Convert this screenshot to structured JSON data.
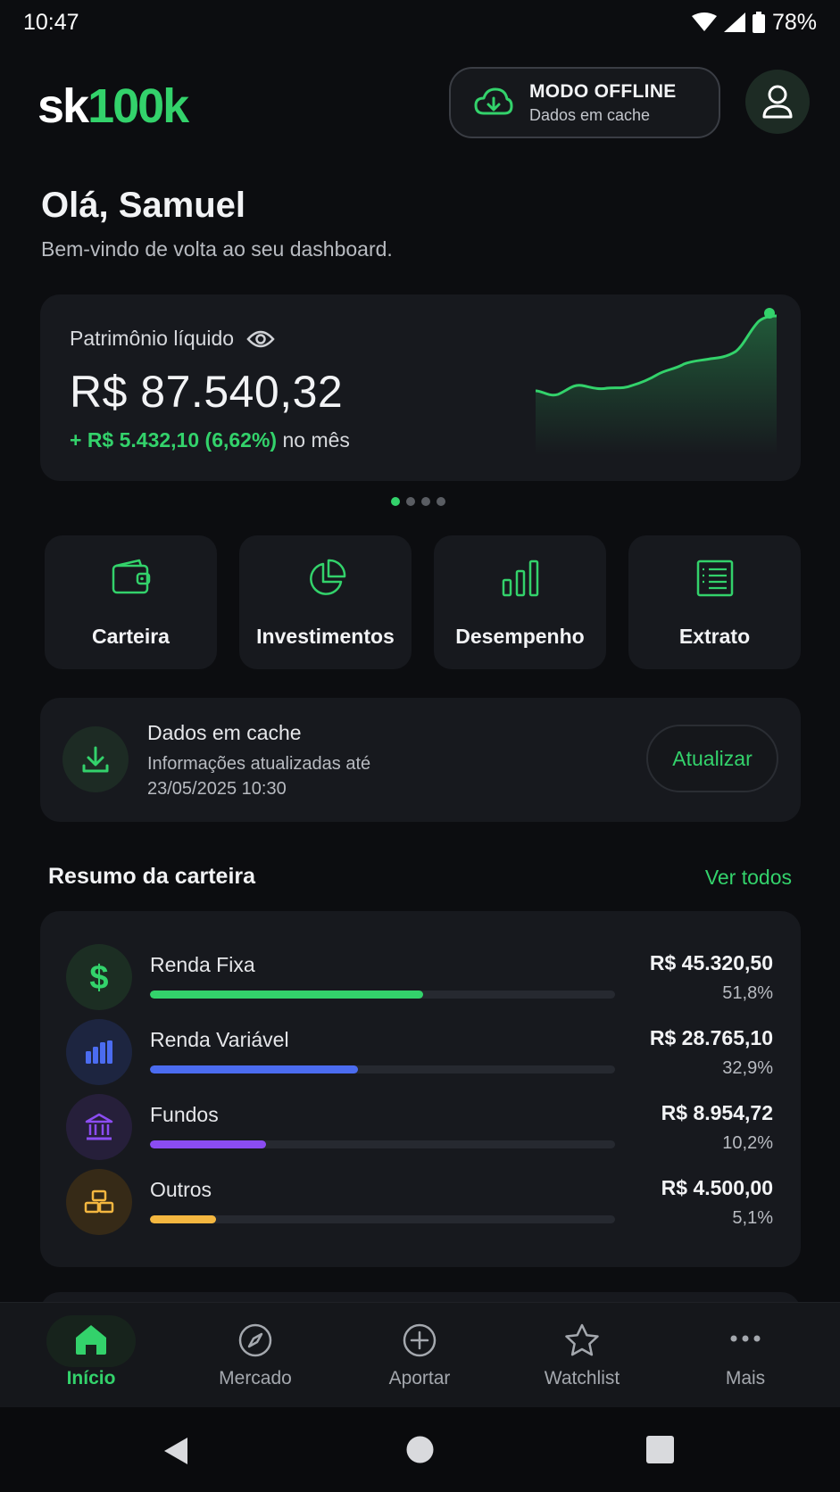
{
  "status": {
    "time": "10:47",
    "battery": "78%"
  },
  "header": {
    "logo_white": "sk",
    "logo_green": "100k",
    "offline_title": "MODO OFFLINE",
    "offline_sub": "Dados em cache"
  },
  "greeting": {
    "title": "Olá, Samuel",
    "subtitle": "Bem-vindo de volta ao seu dashboard."
  },
  "net_worth": {
    "label": "Patrimônio líquido",
    "value": "R$ 87.540,32",
    "change": "+ R$ 5.432,10 (6,62%)",
    "change_suffix": "no mês"
  },
  "carousel": {
    "pages": 4,
    "active": 0
  },
  "quick_actions": [
    {
      "label": "Carteira",
      "icon": "wallet-icon"
    },
    {
      "label": "Investimentos",
      "icon": "pie-chart-icon"
    },
    {
      "label": "Desempenho",
      "icon": "bar-chart-icon"
    },
    {
      "label": "Extrato",
      "icon": "statement-icon"
    }
  ],
  "cache": {
    "title": "Dados em cache",
    "subtitle": "Informações atualizadas até 23/05/2025 10:30",
    "button": "Atualizar"
  },
  "portfolio": {
    "title": "Resumo da carteira",
    "see_all": "Ver todos",
    "items": [
      {
        "name": "Renda Fixa",
        "value": "R$ 45.320,50",
        "percent": "51,8%",
        "share": 0.588,
        "color": "#33d26b",
        "bg": "#1c2e23",
        "icon": "dollar-icon"
      },
      {
        "name": "Renda Variável",
        "value": "R$ 28.765,10",
        "percent": "32,9%",
        "share": 0.447,
        "color": "#4b6cf0",
        "bg": "#1d2540",
        "icon": "bar-chart-icon"
      },
      {
        "name": "Fundos",
        "value": "R$ 8.954,72",
        "percent": "10,2%",
        "share": 0.249,
        "color": "#8b4cf2",
        "bg": "#261f3a",
        "icon": "bank-icon"
      },
      {
        "name": "Outros",
        "value": "R$ 4.500,00",
        "percent": "5,1%",
        "share": 0.142,
        "color": "#f4b740",
        "bg": "#362a17",
        "icon": "gold-bars-icon"
      }
    ]
  },
  "nav": [
    {
      "label": "Início",
      "icon": "home-icon",
      "active": true
    },
    {
      "label": "Mercado",
      "icon": "compass-icon",
      "active": false
    },
    {
      "label": "Aportar",
      "icon": "plus-circle-icon",
      "active": false
    },
    {
      "label": "Watchlist",
      "icon": "star-icon",
      "active": false
    },
    {
      "label": "Mais",
      "icon": "more-icon",
      "active": false
    }
  ],
  "colors": {
    "accent": "#33d26b",
    "background": "#0c0d10",
    "card": "#17191e"
  }
}
